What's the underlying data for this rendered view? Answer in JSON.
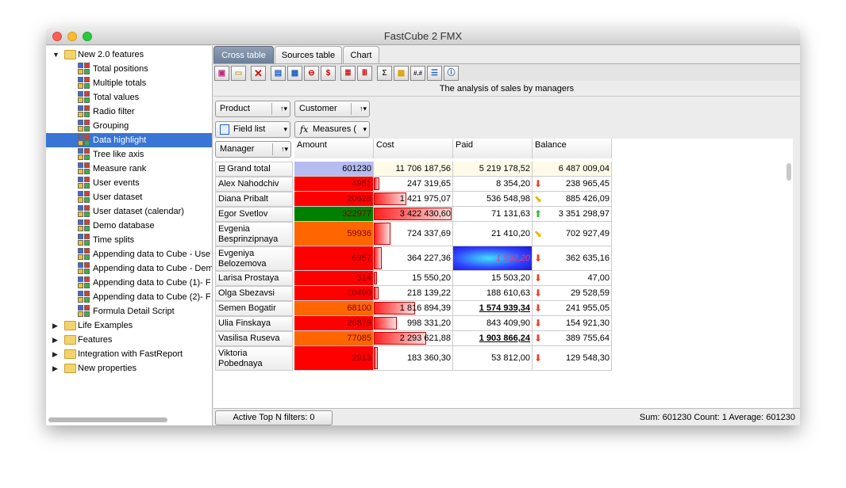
{
  "window": {
    "title": "FastCube 2 FMX"
  },
  "tree": {
    "root": "New 2.0 features",
    "children": [
      "Total positions",
      "Multiple totals",
      "Total values",
      "Radio filter",
      "Grouping",
      "Data highlight",
      "Tree like axis",
      "Measure rank",
      "User events",
      "User dataset",
      "User dataset (calendar)",
      "Demo database",
      "Time splits",
      "Appending data to Cube - Use",
      "Appending data to Cube - Dem",
      "Appending data to Cube (1)- F",
      "Appending data to Cube (2)- F",
      "Formula Detail Script"
    ],
    "selected": "Data highlight",
    "others": [
      "Life Examples",
      "Features",
      "Integration with FastReport",
      "New properties"
    ]
  },
  "tabs": [
    "Cross table",
    "Sources table",
    "Chart"
  ],
  "caption": "The analysis of sales by managers",
  "fields": {
    "product": "Product",
    "customer": "Customer",
    "field_list": "Field list",
    "measures": "Measures (",
    "manager": "Manager"
  },
  "columns": [
    "Amount",
    "Cost",
    "Paid",
    "Balance"
  ],
  "grand_total": {
    "label": "Grand total",
    "amount": "601230",
    "cost": "11 706 187,56",
    "paid": "5 219 178,52",
    "balance": "6 487 009,04"
  },
  "rows": [
    {
      "name": "Alex Nahodchiv",
      "amount": "4951",
      "cost": "247 319,65",
      "paid": "8 354,20",
      "balance": "238 965,45",
      "arrow": "down"
    },
    {
      "name": "Diana Pribalt",
      "amount": "20628",
      "cost": "1 421 975,07",
      "paid": "536 548,98",
      "balance": "885 426,09",
      "arrow": "diag"
    },
    {
      "name": "Egor Svetlov",
      "amount": "322977",
      "cost": "3 422 430,60",
      "paid": "71 131,63",
      "balance": "3 351 298,97",
      "arrow": "up"
    },
    {
      "name": "Evgenia Besprinzipnaya",
      "amount": "59936",
      "cost": "724 337,69",
      "paid": "21 410,20",
      "balance": "702 927,49",
      "arrow": "diag"
    },
    {
      "name": "Evgeniya Belozemova",
      "amount": "6957",
      "cost": "364 227,36",
      "paid": "1 592,20",
      "balance": "362 635,16",
      "arrow": "down"
    },
    {
      "name": "Larisa Prostaya",
      "amount": "314",
      "cost": "15 550,20",
      "paid": "15 503,20",
      "balance": "47,00",
      "arrow": "down"
    },
    {
      "name": "Olga Sbezavsi",
      "amount": "10490",
      "cost": "218 139,22",
      "paid": "188 610,63",
      "balance": "29 528,59",
      "arrow": "down"
    },
    {
      "name": "Semen Bogatir",
      "amount": "68100",
      "cost": "1 816 894,39",
      "paid": "1 574 939,34",
      "balance": "241 955,05",
      "arrow": "down"
    },
    {
      "name": "Ulia Finskaya",
      "amount": "26879",
      "cost": "998 331,20",
      "paid": "843 409,90",
      "balance": "154 921,30",
      "arrow": "down"
    },
    {
      "name": "Vasilisa Ruseva",
      "amount": "77085",
      "cost": "2 293 621,88",
      "paid": "1 903 866,24",
      "balance": "389 755,64",
      "arrow": "down"
    },
    {
      "name": "Viktoria Pobednaya",
      "amount": "2913",
      "cost": "183 360,30",
      "paid": "53 812,00",
      "balance": "129 548,30",
      "arrow": "down"
    }
  ],
  "colors": {
    "selection": "#3875d7",
    "red": "#ff0000",
    "green": "#008000",
    "orange": "#ff6600"
  },
  "status": {
    "topn": "Active Top N filters: 0",
    "summary": "Sum: 601230  Count: 1  Average: 601230"
  }
}
